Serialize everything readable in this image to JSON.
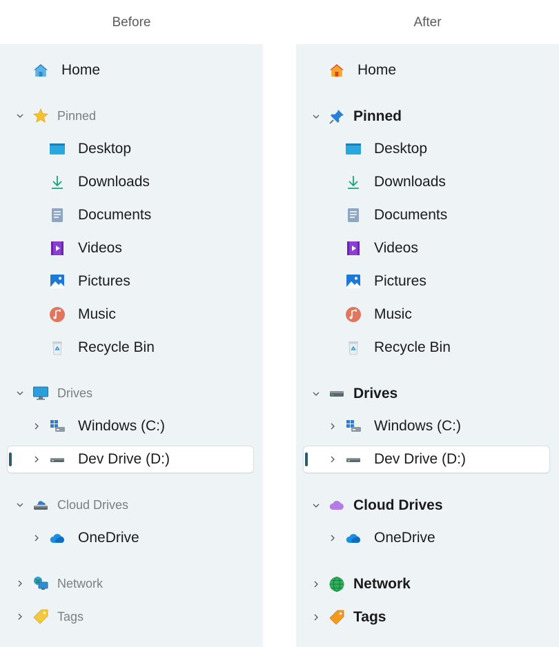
{
  "captions": {
    "before": "Before",
    "after": "After"
  },
  "items": {
    "home": "Home",
    "pinned": "Pinned",
    "desktop": "Desktop",
    "downloads": "Downloads",
    "documents": "Documents",
    "videos": "Videos",
    "pictures": "Pictures",
    "music": "Music",
    "recycle_bin": "Recycle Bin",
    "drives": "Drives",
    "windows_c": "Windows (C:)",
    "dev_drive_d": "Dev Drive (D:)",
    "cloud_drives": "Cloud Drives",
    "onedrive": "OneDrive",
    "network": "Network",
    "tags": "Tags"
  },
  "icons": {
    "before": {
      "home": "home-icon-blue",
      "pinned": "star-icon",
      "drives": "monitor-icon",
      "cloud_drives": "cloud-drive-icon",
      "network": "network-computer-icon",
      "tags": "tag-icon-yellow"
    },
    "after": {
      "home": "home-icon-orange",
      "pinned": "pushpin-icon",
      "drives": "drive-icon",
      "cloud_drives": "cloud-icon-purple",
      "network": "globe-icon",
      "tags": "tag-icon-orange"
    }
  },
  "colors": {
    "selection_indicator": "#2f5a72",
    "panel_bg": "#eef4f6"
  }
}
